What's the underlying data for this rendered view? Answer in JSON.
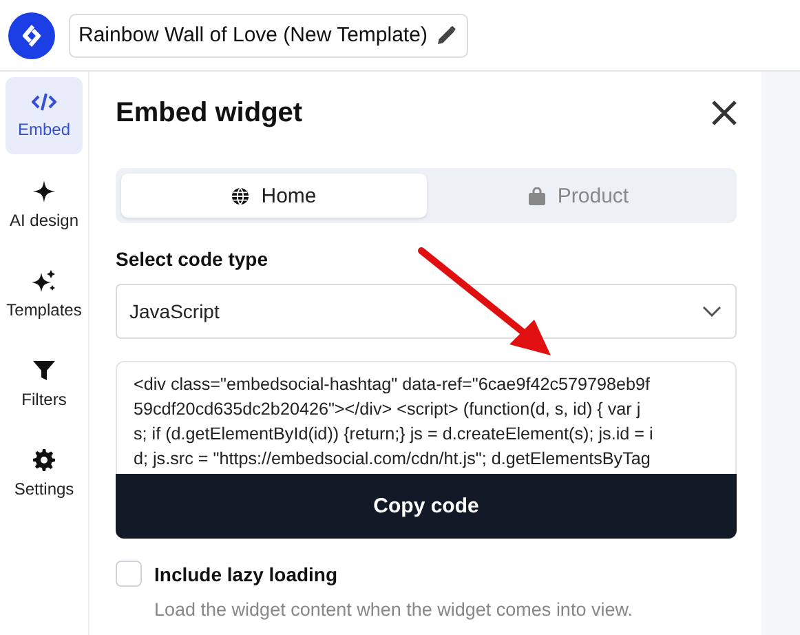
{
  "header": {
    "title": "Rainbow Wall of Love (New Template)"
  },
  "sidebar": {
    "items": [
      {
        "label": "Embed",
        "kind": "code",
        "selected": true
      },
      {
        "label": "AI design",
        "kind": "sparkle",
        "selected": false
      },
      {
        "label": "Templates",
        "kind": "sparkles",
        "selected": false
      },
      {
        "label": "Filters",
        "kind": "filter",
        "selected": false
      },
      {
        "label": "Settings",
        "kind": "gear",
        "selected": false
      }
    ]
  },
  "panel": {
    "title": "Embed widget",
    "tabs": [
      {
        "label": "Home",
        "kind": "globe",
        "selected": true
      },
      {
        "label": "Product",
        "kind": "bag",
        "selected": false
      }
    ],
    "code_type_label": "Select code type",
    "code_type": {
      "value": "JavaScript"
    },
    "code_lines": [
      "<div class=\"embedsocial-hashtag\" data-ref=\"6cae9f42c579798eb9f",
      "59cdf20cd635dc2b20426\"></div> <script> (function(d, s, id) { var j",
      "s; if (d.getElementById(id)) {return;} js = d.createElement(s); js.id = i",
      "d; js.src = \"https://embedsocial.com/cdn/ht.js\"; d.getElementsByTag"
    ],
    "copy_button": "Copy code",
    "lazy_loading": {
      "label": "Include lazy loading",
      "checked": false,
      "description": "Load the widget content when the widget comes into view."
    }
  },
  "annotation": {
    "kind": "arrow"
  }
}
